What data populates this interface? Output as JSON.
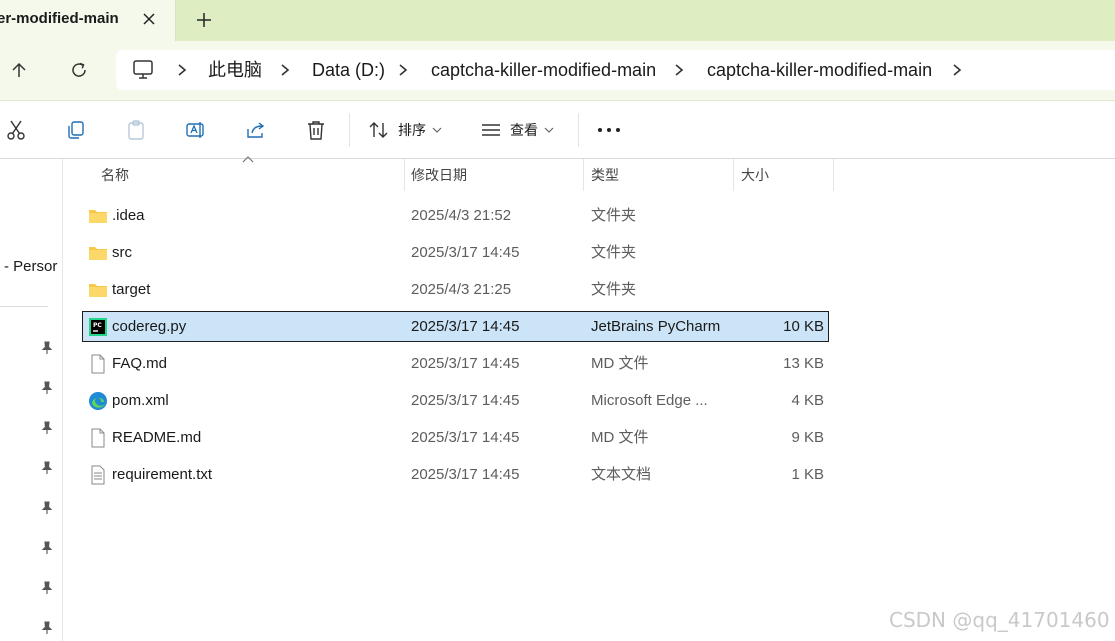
{
  "tab": {
    "title": "er-modified-main"
  },
  "address": {
    "root": "此电脑",
    "crumbs": [
      "Data (D:)",
      "captcha-killer-modified-main",
      "captcha-killer-modified-main"
    ]
  },
  "toolbar": {
    "sort_label": "排序",
    "view_label": "查看"
  },
  "sidebar": {
    "onedrive_label": "- Persor"
  },
  "columns": {
    "name": "名称",
    "date": "修改日期",
    "type": "类型",
    "size": "大小"
  },
  "files": [
    {
      "name": ".idea",
      "date": "2025/4/3 21:52",
      "type": "文件夹",
      "size": "",
      "icon": "folder-icon"
    },
    {
      "name": "src",
      "date": "2025/3/17 14:45",
      "type": "文件夹",
      "size": "",
      "icon": "folder-icon"
    },
    {
      "name": "target",
      "date": "2025/4/3 21:25",
      "type": "文件夹",
      "size": "",
      "icon": "folder-icon"
    },
    {
      "name": "codereg.py",
      "date": "2025/3/17 14:45",
      "type": "JetBrains PyCharm",
      "size": "10 KB",
      "icon": "pycharm-file-icon",
      "selected": true
    },
    {
      "name": "FAQ.md",
      "date": "2025/3/17 14:45",
      "type": "MD 文件",
      "size": "13 KB",
      "icon": "document-icon"
    },
    {
      "name": "pom.xml",
      "date": "2025/3/17 14:45",
      "type": "Microsoft Edge ...",
      "size": "4 KB",
      "icon": "edge-file-icon"
    },
    {
      "name": "README.md",
      "date": "2025/3/17 14:45",
      "type": "MD 文件",
      "size": "9 KB",
      "icon": "document-icon"
    },
    {
      "name": "requirement.txt",
      "date": "2025/3/17 14:45",
      "type": "文本文档",
      "size": "1 KB",
      "icon": "text-file-icon"
    }
  ],
  "watermark": "CSDN @qq_41701460",
  "colors": {
    "titlebar": "#dfeec2",
    "selection": "#cce4f7",
    "folder": "#f7c84a"
  }
}
